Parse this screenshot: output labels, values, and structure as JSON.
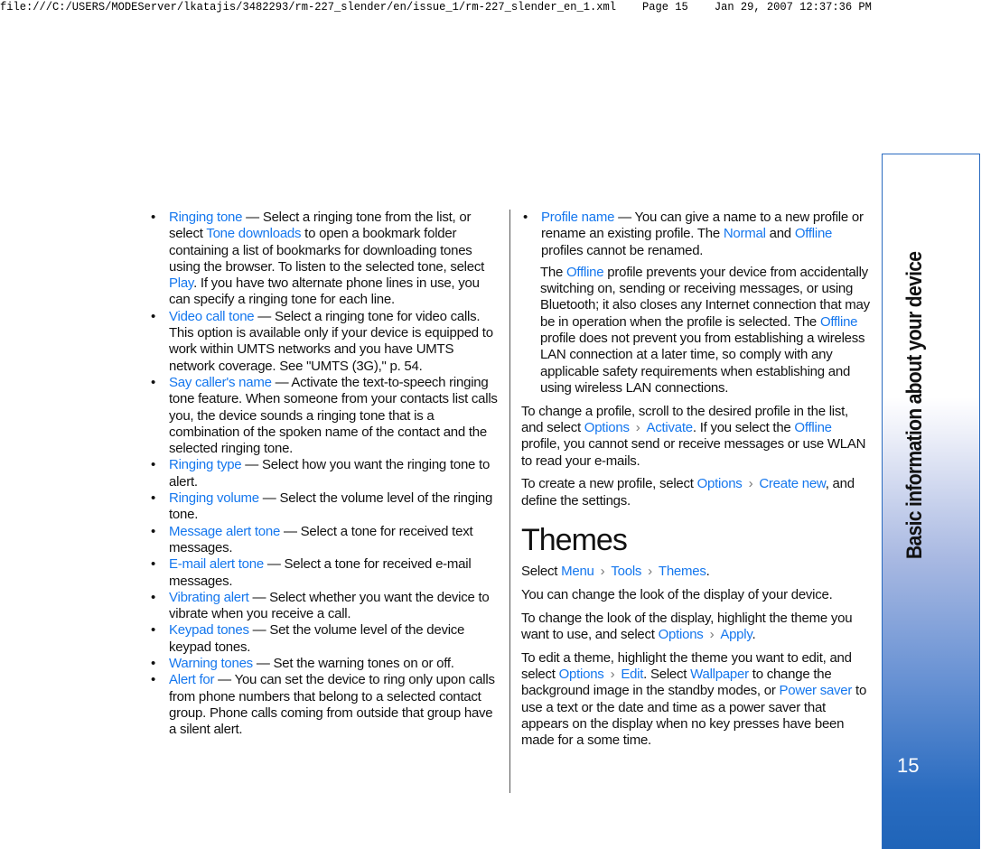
{
  "header": "file:///C:/USERS/MODEServer/lkatajis/3482293/rm-227_slender/en/issue_1/rm-227_slender_en_1.xml    Page 15    Jan 29, 2007 12:37:36 PM",
  "colors": {
    "link": "#1577ee",
    "sidebar_bottom": "#1f64b8"
  },
  "left_items": [
    [
      {
        "t": "Ringing tone",
        "l": 1
      },
      {
        "t": " —  Select a ringing tone from the list, or select "
      },
      {
        "t": "Tone downloads",
        "l": 1
      },
      {
        "t": " to open a bookmark folder containing a list of bookmarks for downloading tones using the browser. To listen to the selected tone, select "
      },
      {
        "t": "Play",
        "l": 1
      },
      {
        "t": ". If you have two alternate phone lines in use, you can specify a ringing tone for each line."
      }
    ],
    [
      {
        "t": "Video call tone",
        "l": 1
      },
      {
        "t": " —  Select a ringing tone for video calls. This option is available only if your device is equipped to work within UMTS networks and you have UMTS network coverage. See \"UMTS (3G),\" p. 54."
      }
    ],
    [
      {
        "t": "Say caller's name",
        "l": 1
      },
      {
        "t": " —  Activate the text-to-speech ringing tone feature. When someone from your contacts list calls you, the device sounds a ringing tone that is a combination of the spoken name of the contact and the selected ringing tone."
      }
    ],
    [
      {
        "t": "Ringing type",
        "l": 1
      },
      {
        "t": " —  Select how you want the ringing tone to alert."
      }
    ],
    [
      {
        "t": "Ringing volume",
        "l": 1
      },
      {
        "t": " —  Select the volume level of the ringing tone."
      }
    ],
    [
      {
        "t": "Message alert tone",
        "l": 1
      },
      {
        "t": " —  Select a tone for received text messages."
      }
    ],
    [
      {
        "t": "E-mail alert tone",
        "l": 1
      },
      {
        "t": " —  Select a tone for received e-mail messages."
      }
    ],
    [
      {
        "t": "Vibrating alert",
        "l": 1
      },
      {
        "t": " —  Select whether you want the device to vibrate when you receive a call."
      }
    ],
    [
      {
        "t": "Keypad tones",
        "l": 1
      },
      {
        "t": " —  Set the volume level of the device keypad tones."
      }
    ],
    [
      {
        "t": "Warning tones",
        "l": 1
      },
      {
        "t": " —  Set the warning tones on or off."
      }
    ],
    [
      {
        "t": "Alert for",
        "l": 1
      },
      {
        "t": " —  You can set the device to ring only upon calls from phone numbers that belong to a selected contact group. Phone calls coming from outside that group have a silent alert."
      }
    ]
  ],
  "right": {
    "profile_item": [
      {
        "t": "Profile name",
        "l": 1
      },
      {
        "t": " —  You can give a name to a new profile or rename an existing profile. The "
      },
      {
        "t": "Normal",
        "l": 1
      },
      {
        "t": " and "
      },
      {
        "t": "Offline",
        "l": 1
      },
      {
        "t": " profiles cannot be renamed."
      }
    ],
    "profile_sub": [
      {
        "t": "The "
      },
      {
        "t": "Offline",
        "l": 1
      },
      {
        "t": " profile prevents your device from accidentally switching on, sending or receiving messages, or using Bluetooth; it also closes any Internet connection that may be in operation when the profile is selected. The "
      },
      {
        "t": "Offline",
        "l": 1
      },
      {
        "t": " profile does not prevent you from establishing a wireless LAN connection at a later time, so comply with any applicable safety requirements when establishing and using wireless LAN connections."
      }
    ],
    "paras_before": [
      [
        {
          "t": "To change a profile, scroll to the desired profile in the list, and select "
        },
        {
          "t": "Options",
          "l": 1
        },
        {
          "t": "›",
          "s": 1
        },
        {
          "t": "Activate",
          "l": 1
        },
        {
          "t": ". If you select the "
        },
        {
          "t": "Offline",
          "l": 1
        },
        {
          "t": " profile, you cannot send or receive messages or use WLAN to read your e-mails."
        }
      ],
      [
        {
          "t": "To create a new profile, select "
        },
        {
          "t": "Options",
          "l": 1
        },
        {
          "t": "›",
          "s": 1
        },
        {
          "t": "Create new",
          "l": 1
        },
        {
          "t": ", and define the settings."
        }
      ]
    ],
    "heading": "Themes",
    "paras_after": [
      [
        {
          "t": "Select "
        },
        {
          "t": "Menu",
          "l": 1
        },
        {
          "t": "›",
          "s": 1
        },
        {
          "t": "Tools",
          "l": 1
        },
        {
          "t": "›",
          "s": 1
        },
        {
          "t": "Themes",
          "l": 1
        },
        {
          "t": "."
        }
      ],
      [
        {
          "t": "You can change the look of the display of your device."
        }
      ],
      [
        {
          "t": "To change the look of the display, highlight the theme you want to use, and select "
        },
        {
          "t": "Options",
          "l": 1
        },
        {
          "t": "›",
          "s": 1
        },
        {
          "t": "Apply",
          "l": 1
        },
        {
          "t": "."
        }
      ],
      [
        {
          "t": "To edit a theme, highlight the theme you want to edit, and select "
        },
        {
          "t": "Options",
          "l": 1
        },
        {
          "t": "›",
          "s": 1
        },
        {
          "t": "Edit",
          "l": 1
        },
        {
          "t": ". Select "
        },
        {
          "t": "Wallpaper",
          "l": 1
        },
        {
          "t": " to change the background image in the standby modes, or "
        },
        {
          "t": "Power saver",
          "l": 1
        },
        {
          "t": " to use a text or the date and time as a power saver that appears on the display when no key presses have been made for a some time."
        }
      ]
    ]
  },
  "sidebar": {
    "title": "Basic information about your device",
    "page_number": "15"
  }
}
